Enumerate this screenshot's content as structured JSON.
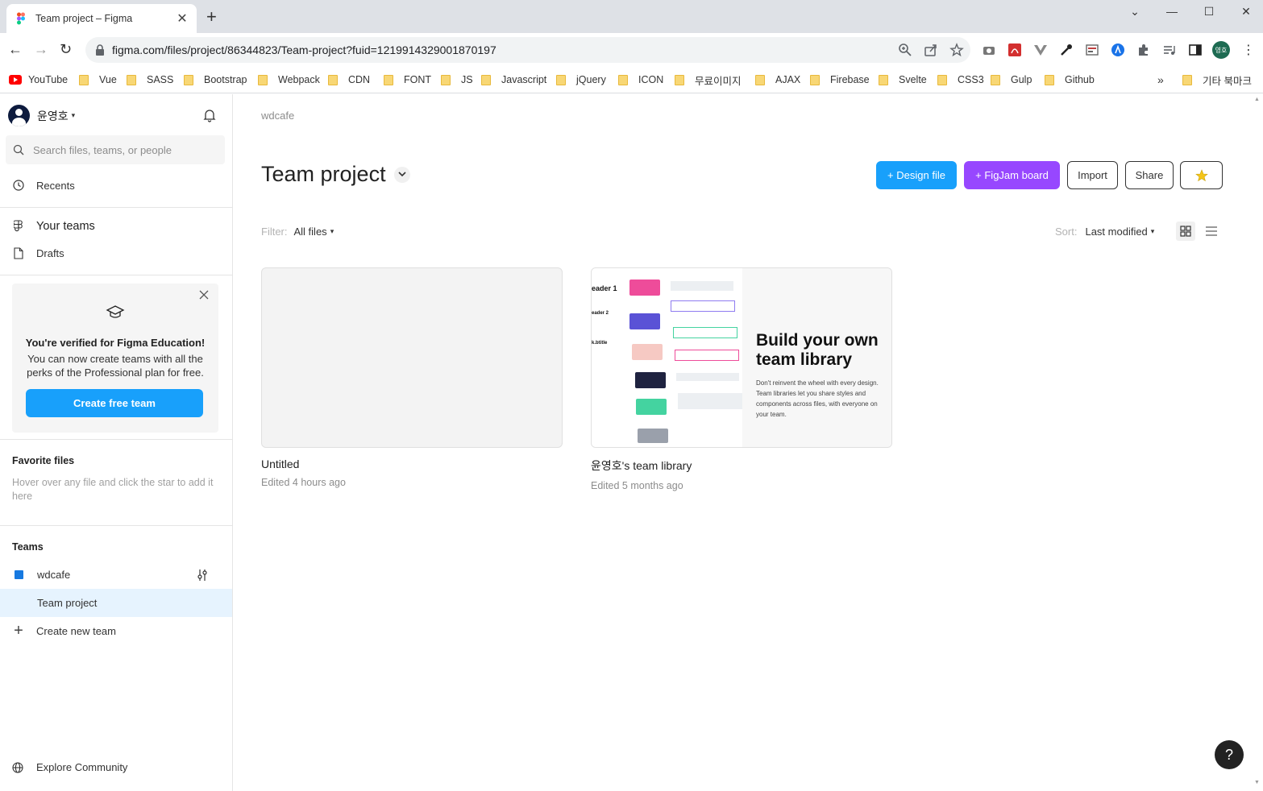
{
  "browser": {
    "tab_title": "Team project – Figma",
    "url": "figma.com/files/project/86344823/Team-project?fuid=1219914329001870197",
    "profile_initials": "영호",
    "bookmarks": [
      "YouTube",
      "Vue",
      "SASS",
      "Bootstrap",
      "Webpack",
      "CDN",
      "FONT",
      "JS",
      "Javascript",
      "jQuery",
      "ICON",
      "무료이미지",
      "AJAX",
      "Firebase",
      "Svelte",
      "CSS3",
      "Gulp",
      "Github"
    ],
    "other_bookmarks": "기타 북마크",
    "overflow": "»"
  },
  "sidebar": {
    "user_name": "윤영호",
    "search_placeholder": "Search files, teams, or people",
    "recents": "Recents",
    "your_teams": "Your teams",
    "drafts": "Drafts",
    "edu": {
      "title": "You're verified for Figma Education!",
      "text": "You can now create teams with all the perks of the Professional plan for free.",
      "button": "Create free team"
    },
    "favorites_title": "Favorite files",
    "favorites_text": "Hover over any file and click the star to add it here",
    "teams_title": "Teams",
    "team_name": "wdcafe",
    "project_name": "Team project",
    "create_team": "Create new team",
    "explore": "Explore Community"
  },
  "main": {
    "breadcrumb": "wdcafe",
    "title": "Team project",
    "buttons": {
      "design_file": "+ Design file",
      "figjam_board": "+ FigJam board",
      "import": "Import",
      "share": "Share"
    },
    "filter_label": "Filter:",
    "filter_value": "All files",
    "sort_label": "Sort:",
    "sort_value": "Last modified",
    "files": [
      {
        "name": "Untitled",
        "meta": "Edited 4 hours ago"
      },
      {
        "name": "윤영호's team library",
        "meta": "Edited 5 months ago"
      }
    ],
    "library_thumb": {
      "heading": "Build your own team library",
      "desc": "Don't reinvent the wheel with every design. Team libraries let you share styles and components across files, with everyone on your team.",
      "labels": [
        "eader 1",
        "eader 2",
        "k.btitle"
      ]
    },
    "help": "?"
  },
  "colors": {
    "figma_blue": "#18a0fb",
    "figjam_purple": "#9747ff",
    "selected_row": "#e6f3fe",
    "team_square": "#1779e0"
  }
}
